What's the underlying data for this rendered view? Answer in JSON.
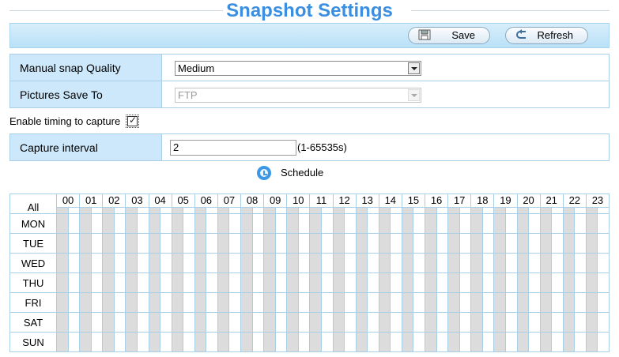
{
  "page": {
    "title": "Snapshot Settings"
  },
  "toolbar": {
    "save_label": "Save",
    "refresh_label": "Refresh"
  },
  "form": {
    "quality_label": "Manual snap Quality",
    "quality_value": "Medium",
    "save_to_label": "Pictures Save To",
    "save_to_value": "FTP"
  },
  "timing": {
    "enable_label": "Enable timing to capture",
    "enabled": true,
    "interval_label": "Capture interval",
    "interval_value": "2",
    "interval_range": "(1-65535s)"
  },
  "schedule": {
    "label": "Schedule",
    "all_label": "All",
    "days": [
      "MON",
      "TUE",
      "WED",
      "THU",
      "FRI",
      "SAT",
      "SUN"
    ],
    "hours": [
      "00",
      "01",
      "02",
      "03",
      "04",
      "05",
      "06",
      "07",
      "08",
      "09",
      "10",
      "11",
      "12",
      "13",
      "14",
      "15",
      "16",
      "17",
      "18",
      "19",
      "20",
      "21",
      "22",
      "23"
    ]
  },
  "colors": {
    "title": "#3c8ee0",
    "label_bg": "#cde8fa",
    "border": "#a9cfe8",
    "half_hour_shade": "#dcdcdc"
  }
}
